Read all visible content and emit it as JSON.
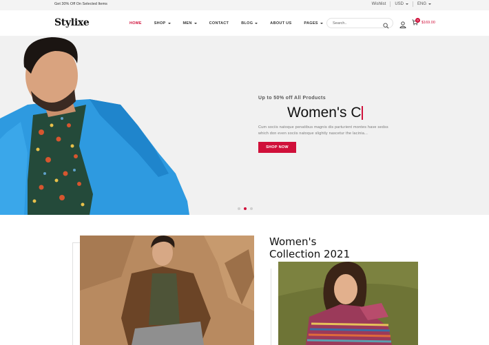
{
  "topbar": {
    "promo": "Get 30% Off On Selected Items",
    "wishlist": "Wishlist",
    "currency": "USD",
    "language": "ENG"
  },
  "header": {
    "logo": "Stylixe",
    "nav": [
      {
        "label": "HOME",
        "active": true,
        "dropdown": false
      },
      {
        "label": "SHOP",
        "active": false,
        "dropdown": true
      },
      {
        "label": "MEN",
        "active": false,
        "dropdown": true
      },
      {
        "label": "CONTACT",
        "active": false,
        "dropdown": false
      },
      {
        "label": "BLOG",
        "active": false,
        "dropdown": true
      },
      {
        "label": "ABOUT US",
        "active": false,
        "dropdown": false
      },
      {
        "label": "PAGES",
        "active": false,
        "dropdown": true
      }
    ],
    "search_placeholder": "Search..",
    "cart_count": "0",
    "cart_total": "$169.00"
  },
  "hero": {
    "subtitle": "Up to 50% off All Products",
    "title": "Women's C",
    "description": "Cum sociis natoque penatibus magnis dis parturient montes have sedss which don even sociis natoque slightly nascetur the lacinia...",
    "button": "SHOP NOW",
    "slides": 3,
    "active_slide": 2
  },
  "collection": {
    "title_line1": "Women's",
    "title_line2": "Collection 2021"
  },
  "colors": {
    "accent": "#d0103a",
    "topbar_bg": "#f4f4f4",
    "hero_bg": "#f1f1f1"
  }
}
